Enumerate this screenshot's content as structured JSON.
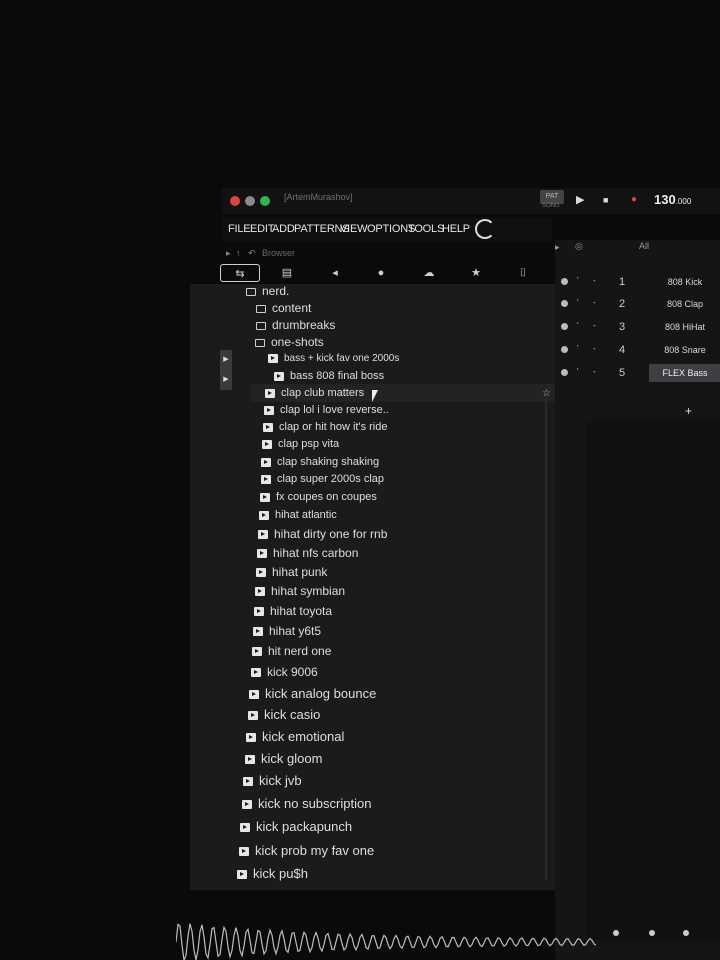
{
  "window": {
    "title": "[ArtemMurashov]",
    "pat_label": "PAT",
    "song_label": "SONG",
    "tempo": "130",
    "tempo_decimal": ".000"
  },
  "menu": [
    "FILE",
    "EDIT",
    "ADD",
    "PATTERNS",
    "VIEW",
    "OPTIONS",
    "TOOLS",
    "HELP"
  ],
  "browser": {
    "label": "Browser",
    "tabs": [
      {
        "icon": "waveform-icon",
        "glyph": "⇆"
      },
      {
        "icon": "document-icon",
        "glyph": "▤"
      },
      {
        "icon": "plugin-icon",
        "glyph": "◂"
      },
      {
        "icon": "globe-icon",
        "glyph": "●"
      },
      {
        "icon": "cloud-icon",
        "glyph": "☁"
      },
      {
        "icon": "star-icon",
        "glyph": "★"
      },
      {
        "icon": "folder-icon",
        "glyph": "⌷"
      }
    ],
    "folders": [
      "nerd.",
      "content",
      "drumbreaks",
      "one-shots"
    ],
    "ghost_text": "kick fav one 2000s",
    "files": [
      "bass + kick fav one 2000s",
      "bass 808 final boss",
      "clap club matters",
      "clap lol i love reverse..",
      "clap or hit how it's ride",
      "clap psp vita",
      "clap shaking shaking",
      "clap super 2000s clap",
      "fx coupes on coupes",
      "hihat atlantic",
      "hihat dirty one for rnb",
      "hihat nfs carbon",
      "hihat punk",
      "hihat symbian",
      "hihat toyota",
      "hihat y6t5",
      "hit nerd one",
      "kick 9006",
      "kick analog bounce",
      "kick casio",
      "kick emotional",
      "kick gloom",
      "kick jvb",
      "kick no subscription",
      "kick packapunch",
      "kick prob my fav one",
      "kick pu$h"
    ]
  },
  "channel_rack": {
    "filter": "All",
    "channels": [
      {
        "num": "1",
        "name": "808 Kick"
      },
      {
        "num": "2",
        "name": "808 Clap"
      },
      {
        "num": "3",
        "name": "808 HiHat"
      },
      {
        "num": "4",
        "name": "808 Snare"
      },
      {
        "num": "5",
        "name": "FLEX Bass"
      }
    ],
    "add_label": "+"
  }
}
